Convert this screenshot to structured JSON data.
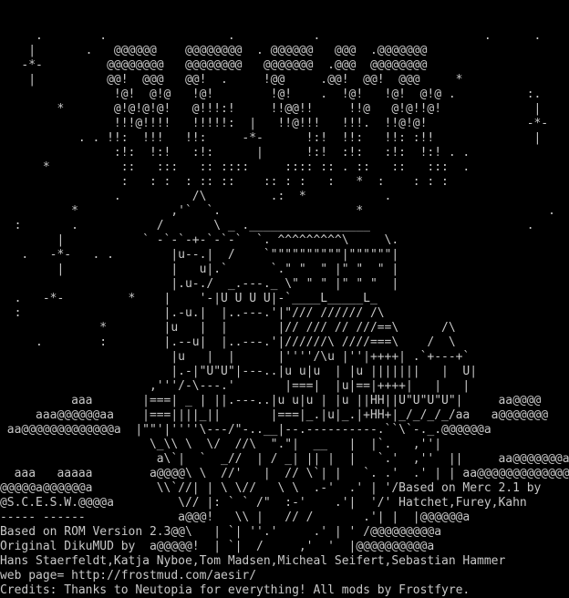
{
  "terminal": {
    "background": "#000000",
    "foreground": "#c8c8c8",
    "banner_lines": [
      "",
      "",
      "     .        .                 .           .                       .      .",
      "    |       .   @@@@@@    @@@@@@@@  . @@@@@@   @@@  .@@@@@@@",
      "   -*-         @@@@@@@@   @@@@@@@@   @@@@@@@  .@@@  @@@@@@@@",
      "    |          @@!  @@@   @@!  .     !@@     .@@!  @@!  @@@     *",
      "                !@!  @!@   !@!        !@!    .  !@!   !@!  @!@ .          :.",
      "        *       @!@!@!@!   @!!!:!     !!@@!!     !!@   @!@!!@!             |",
      "                !!!@!!!!   !!!!!:  |   !!@!!!   !!!.  !!@!@!              -*-",
      "           . . !!:  !!!   !!:     -*-      !:!  !!:   !!: :!!              |",
      "                :!:  !:!   :!:      |      !:!  :!:   :!:  !:! . .",
      "      *          ::   :::   :: ::::     :::: :: . ::   ::   :::  .",
      "                 :   : :  : :: ::    :: : :   :   *  :    : : :",
      "                .          /\\         .:  *           .",
      "          *             ,'`  `.                   *                          .",
      "  :       .           /       \\ _ ._________________                      .",
      "        |           ` -`-`-+-`-`-`  `. ^^^^^^^^^\\     \\.",
      "   .   -*-   . .        |u--.|  /    `\"\"\"\"\"\"\"\"\"\"|\"\"\"\"\"\"|",
      "        |               |   u|.`      `.\" \"  \" |\" \"  \" |",
      "                        |.u-./  _.---._ \\\" \" \" |\" \" \"  |",
      "  .   -*-         *    |    '-|U U U U|-`____L_____L_",
      "  :                    |.-u.|  |..---.'|\"/// ////// /\\",
      "              *        |u   |  |       |// /// // ///==\\      /\\",
      "     .        :        |.--u|  |..---.'|//////\\ ////===\\    /  \\",
      "                        |u   |  |      |''''/\\u |''|++++| .`+---+`",
      "                        |.-|\"U\"U\"|---..|u u|u  | |u |||||||   |  U|",
      "                     ,'''/-\\---.'       |===|  |u|==|++++|   |   |",
      "          aaa       |===| _ | ||.---..|u u|u | |u ||HH||U\"U\"U\"U\"|     aa@@@@",
      "     aaa@@@@@@aa    |===||||_||       |===|_.|u|_.|+HH+|_/_/_/_/aa   a@@@@@@@",
      " aa@@@@@@@@@@@@@a  |\"\"'|''''\\---/\"-..__|--.----------.``\\`-._.@@@@@@a",
      "                     \\_\\\\ \\  \\/  //\\  \".\"|  __   |  |`.   ,''|",
      "                      a\\`|  `  _//  | / _| || |  |   `.'  ,''  ||     aa@@@@@@@a",
      "  aaa   aaaaa        a@@@@\\ \\  //'   |  // \\`| |   `. .'  .' | | aa@@@@@@@@@@@@@a",
      "@@@@@a@@@@@@a         \\\\`//| | \\ \\//   \\ \\  .-'  .' | '/Based on Merc 2.1 by",
      "@S.C.E.S.W.@@@@a         \\// |: ` ` /\"  :-'    .'|  '/' Hatchet,Furey,Kahn",
      "----- ------             a@@@!   \\\\ |   // /       .'| |  |@@@@@@a",
      "Based on ROM Version 2.3@@\\   | `| ''.'     .' | ' /@@@@@@@@@a",
      "Original DikuMUD by  a@@@@@!  | `|  /     ,'  '  |@@@@@@@@@@a",
      "Hans Staerfeldt,Katja Nyboe,Tom Madsen,Micheal Seifert,Sebastian Hammer",
      "web page= http://frostmud.com/aesir/",
      "Credits: Thanks to Neutopia for everything! All mods by Frostfyre."
    ]
  }
}
